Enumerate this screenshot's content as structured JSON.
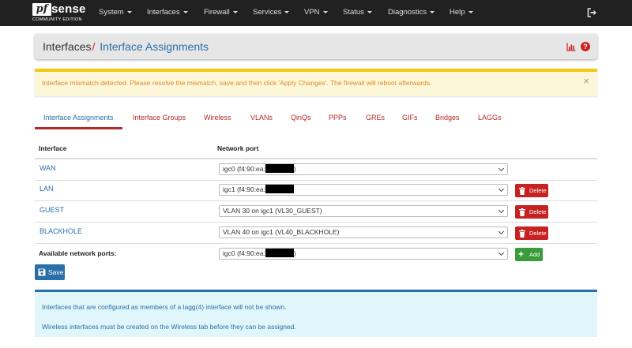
{
  "brand": {
    "logo": "pf",
    "name": "sense",
    "edition": "COMMUNITY EDITION"
  },
  "nav": [
    "System",
    "Interfaces",
    "Firewall",
    "Services",
    "VPN",
    "Status",
    "Diagnostics",
    "Help"
  ],
  "breadcrumb": {
    "parent": "Interfaces",
    "separator": "/",
    "current": "Interface Assignments"
  },
  "alert": {
    "message": "Interface mismatch detected. Please resolve the mismatch, save and then click 'Apply Changes'. The firewall will reboot afterwards.",
    "close": "×"
  },
  "tabs": [
    "Interface Assignments",
    "Interface Groups",
    "Wireless",
    "VLANs",
    "QinQs",
    "PPPs",
    "GREs",
    "GIFs",
    "Bridges",
    "LAGGs"
  ],
  "table": {
    "headers": [
      "Interface",
      "Network port"
    ],
    "rows": [
      {
        "name": "WAN",
        "port_prefix": "igc0 (f4:90:ea:",
        "port_suffix": ")",
        "redacted": true
      },
      {
        "name": "LAN",
        "port_prefix": "igc1 (f4:90:ea:",
        "port_suffix": "",
        "redacted": true,
        "action": "Delete"
      },
      {
        "name": "GUEST",
        "port_prefix": "VLAN 30 on igc1 (VL30_GUEST)",
        "port_suffix": "",
        "redacted": false,
        "action": "Delete"
      },
      {
        "name": "BLACKHOLE",
        "port_prefix": "VLAN 40 on igc1 (VL40_BLACKHOLE)",
        "port_suffix": "",
        "redacted": false,
        "action": "Delete"
      }
    ],
    "available": {
      "label": "Available network ports:",
      "port_prefix": "igc0 (f4:90:ea:",
      "port_suffix": ")",
      "action": "Add"
    }
  },
  "save_label": "Save",
  "info": [
    "Interfaces that are configured as members of a lagg(4) interface will not be shown.",
    "Wireless interfaces must be created on the Wireless tab before they can be assigned."
  ],
  "colors": {
    "navbar": "#212121",
    "accent_red": "#b22a2a",
    "link_blue": "#2a6fa8",
    "delete_red": "#c62222",
    "add_green": "#3a9b3a",
    "warning_text": "#e0892a"
  }
}
